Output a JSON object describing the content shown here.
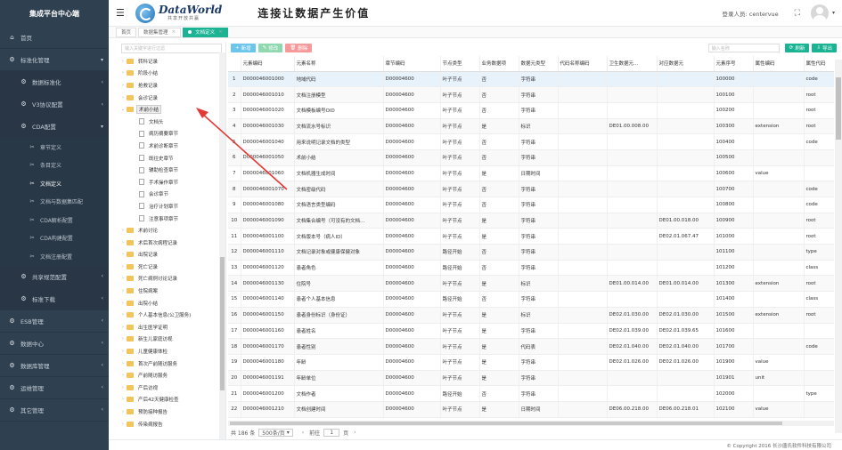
{
  "sidebar": {
    "brand": "集成平台中心端",
    "items": [
      {
        "icon": "home-icon",
        "label": "首页",
        "arrow": ""
      },
      {
        "icon": "gear-icon",
        "label": "标准化管理",
        "arrow": "▾"
      },
      {
        "icon": "gear-icon",
        "label": "数据标准化",
        "arrow": "‹",
        "sub": true
      },
      {
        "icon": "gear-icon",
        "label": "V3协议配置",
        "arrow": "‹",
        "sub": true
      },
      {
        "icon": "gear-icon",
        "label": "CDA配置",
        "arrow": "▾",
        "sub": true
      },
      {
        "icon": "wrench-icon",
        "label": "章节定义",
        "sub2": true
      },
      {
        "icon": "wrench-icon",
        "label": "条目定义",
        "sub2": true
      },
      {
        "icon": "wrench-icon",
        "label": "文档定义",
        "sub2": true,
        "current": true
      },
      {
        "icon": "wrench-icon",
        "label": "文档与数据集匹配",
        "sub2": true
      },
      {
        "icon": "wrench-icon",
        "label": "CDA解析配置",
        "sub2": true
      },
      {
        "icon": "wrench-icon",
        "label": "CDA构建配置",
        "sub2": true
      },
      {
        "icon": "wrench-icon",
        "label": "文档注册配置",
        "sub2": true
      },
      {
        "icon": "gear-icon",
        "label": "共享规范配置",
        "arrow": "‹",
        "sub": true
      },
      {
        "icon": "gear-icon",
        "label": "标准下载",
        "arrow": "‹",
        "sub": true
      },
      {
        "icon": "gear-icon",
        "label": "ESB管理",
        "arrow": "‹"
      },
      {
        "icon": "gear-icon",
        "label": "数据中心",
        "arrow": "‹"
      },
      {
        "icon": "gear-icon",
        "label": "数据库管理",
        "arrow": "‹"
      },
      {
        "icon": "gear-icon",
        "label": "运维管理",
        "arrow": "‹"
      },
      {
        "icon": "gear-icon",
        "label": "其它管理",
        "arrow": "‹"
      }
    ]
  },
  "header": {
    "logo_title": "DataWorld",
    "logo_sub": "共享开放共赢",
    "slogan": "连接让数据产生价值",
    "user_label": "登录人员: centervue"
  },
  "tabs": [
    {
      "label": "首页",
      "closable": false,
      "active": false
    },
    {
      "label": "数据集管理",
      "closable": true,
      "active": false
    },
    {
      "label": "文档定义",
      "closable": true,
      "active": true
    }
  ],
  "tree": {
    "search_placeholder": "输入关键字进行过滤",
    "nodes": [
      {
        "label": "转科记录",
        "level": 1,
        "type": "folder",
        "tog": "›"
      },
      {
        "label": "阶段小结",
        "level": 1,
        "type": "folder",
        "tog": "›"
      },
      {
        "label": "抢救记录",
        "level": 1,
        "type": "folder",
        "tog": "›"
      },
      {
        "label": "会诊记录",
        "level": 1,
        "type": "folder",
        "tog": "›"
      },
      {
        "label": "术前小结",
        "level": 1,
        "type": "folder",
        "tog": "⌄",
        "selected": true
      },
      {
        "label": "文档头",
        "level": 2,
        "type": "doc"
      },
      {
        "label": "病历摘要章节",
        "level": 2,
        "type": "doc"
      },
      {
        "label": "术前诊断章节",
        "level": 2,
        "type": "doc"
      },
      {
        "label": "既往史章节",
        "level": 2,
        "type": "doc"
      },
      {
        "label": "辅助检查章节",
        "level": 2,
        "type": "doc"
      },
      {
        "label": "手术操作章节",
        "level": 2,
        "type": "doc"
      },
      {
        "label": "会诊章节",
        "level": 2,
        "type": "doc"
      },
      {
        "label": "治疗计划章节",
        "level": 2,
        "type": "doc"
      },
      {
        "label": "注意事项章节",
        "level": 2,
        "type": "doc"
      },
      {
        "label": "术前讨论",
        "level": 1,
        "type": "folder",
        "tog": "›"
      },
      {
        "label": "术后首次病程记录",
        "level": 1,
        "type": "folder",
        "tog": "›"
      },
      {
        "label": "出院记录",
        "level": 1,
        "type": "folder",
        "tog": "›"
      },
      {
        "label": "死亡记录",
        "level": 1,
        "type": "folder",
        "tog": "›"
      },
      {
        "label": "死亡病例讨论记录",
        "level": 1,
        "type": "folder",
        "tog": "›"
      },
      {
        "label": "住院病案",
        "level": 1,
        "type": "folder",
        "tog": "›"
      },
      {
        "label": "出院小结",
        "level": 1,
        "type": "folder",
        "tog": "›"
      },
      {
        "label": "个人基本信息(公卫服务)",
        "level": 1,
        "type": "folder",
        "tog": "›"
      },
      {
        "label": "出生医学证明",
        "level": 1,
        "type": "folder",
        "tog": "›"
      },
      {
        "label": "新生儿家庭访视",
        "level": 1,
        "type": "folder",
        "tog": "›"
      },
      {
        "label": "儿童健康体检",
        "level": 1,
        "type": "folder",
        "tog": "›"
      },
      {
        "label": "首次产前随访服务",
        "level": 1,
        "type": "folder",
        "tog": "›"
      },
      {
        "label": "产前随访服务",
        "level": 1,
        "type": "folder",
        "tog": "›"
      },
      {
        "label": "产后访视",
        "level": 1,
        "type": "folder",
        "tog": "›"
      },
      {
        "label": "产后42天健康检查",
        "level": 1,
        "type": "folder",
        "tog": "›"
      },
      {
        "label": "预防接种报告",
        "level": 1,
        "type": "folder",
        "tog": "›"
      },
      {
        "label": "传染病报告",
        "level": 1,
        "type": "folder",
        "tog": "›"
      }
    ]
  },
  "toolbar": {
    "add": "新增",
    "edit": "修改",
    "delete": "删除",
    "search_placeholder": "输入名称",
    "refresh": "刷新",
    "export": "导出"
  },
  "table": {
    "columns": [
      "",
      "元素编码",
      "元素名称",
      "章节编码",
      "节点类型",
      "业务数据项",
      "数据元类型",
      "代码名称编码",
      "卫生数据元...",
      "对应数据元",
      "元素序号",
      "属性编码",
      "属性代码"
    ],
    "rows": [
      [
        "1",
        "D000046001000",
        "地域代码",
        "D00004600",
        "叶子节点",
        "否",
        "字符串",
        "",
        "",
        "",
        "100000",
        "",
        "code"
      ],
      [
        "2",
        "D000046001010",
        "文档注册模型",
        "D00004600",
        "叶子节点",
        "否",
        "字符串",
        "",
        "",
        "",
        "100100",
        "",
        "root"
      ],
      [
        "3",
        "D000046001020",
        "文档模板编号OID",
        "D00004600",
        "叶子节点",
        "否",
        "字符串",
        "",
        "",
        "",
        "100200",
        "",
        "root"
      ],
      [
        "4",
        "D000046001030",
        "文档流水号标识",
        "D00004600",
        "叶子节点",
        "是",
        "标识",
        "",
        "DE01.00.008.00",
        "",
        "100300",
        "extension",
        "root"
      ],
      [
        "5",
        "D000046001040",
        "用来说明记录文档的类型",
        "D00004600",
        "叶子节点",
        "否",
        "字符串",
        "",
        "",
        "",
        "100400",
        "",
        "code"
      ],
      [
        "6",
        "D000046001050",
        "术前小结",
        "D00004600",
        "叶子节点",
        "否",
        "字符串",
        "",
        "",
        "",
        "100500",
        "",
        ""
      ],
      [
        "7",
        "D000046001060",
        "文档机器生成时间",
        "D00004600",
        "叶子节点",
        "是",
        "日期时间",
        "",
        "",
        "",
        "100600",
        "value",
        ""
      ],
      [
        "8",
        "D000046001070",
        "文档密级代码",
        "D00004600",
        "叶子节点",
        "否",
        "字符串",
        "",
        "",
        "",
        "100700",
        "",
        "code"
      ],
      [
        "9",
        "D000046001080",
        "文档语言类型编码",
        "D00004600",
        "叶子节点",
        "否",
        "字符串",
        "",
        "",
        "",
        "100800",
        "",
        "code"
      ],
      [
        "10",
        "D000046001090",
        "文档集合编号（可没有的文档...",
        "D00004600",
        "叶子节点",
        "是",
        "字符串",
        "",
        "",
        "DE01.00.018.00",
        "100900",
        "",
        "root"
      ],
      [
        "11",
        "D000046001100",
        "文档版本号（病人ID）",
        "D00004600",
        "叶子节点",
        "是",
        "字符串",
        "",
        "",
        "DE02.01.067.47",
        "101000",
        "",
        "root"
      ],
      [
        "12",
        "D000046001110",
        "文档记录对象或健康保健对象",
        "D00004600",
        "路径开始",
        "否",
        "字符串",
        "",
        "",
        "",
        "101100",
        "",
        "type"
      ],
      [
        "13",
        "D000046001120",
        "患者角色",
        "D00004600",
        "路径开始",
        "否",
        "字符串",
        "",
        "",
        "",
        "101200",
        "",
        "class"
      ],
      [
        "14",
        "D000046001130",
        "住院号",
        "D00004600",
        "叶子节点",
        "是",
        "标识",
        "",
        "DE01.00.014.00",
        "DE01.00.014.00",
        "101300",
        "extension",
        "root"
      ],
      [
        "15",
        "D000046001140",
        "患者个人基本信息",
        "D00004600",
        "路径开始",
        "否",
        "字符串",
        "",
        "",
        "",
        "101400",
        "",
        "class"
      ],
      [
        "16",
        "D000046001150",
        "患者身份标识（身份证）",
        "D00004600",
        "叶子节点",
        "是",
        "标识",
        "",
        "DE02.01.030.00",
        "DE02.01.030.00",
        "101500",
        "extension",
        "root"
      ],
      [
        "17",
        "D000046001160",
        "患者姓名",
        "D00004600",
        "叶子节点",
        "是",
        "字符串",
        "",
        "DE02.01.039.00",
        "DE02.01.039.65",
        "101600",
        "",
        ""
      ],
      [
        "18",
        "D000046001170",
        "患者性别",
        "D00004600",
        "叶子节点",
        "是",
        "代码表",
        "",
        "DE02.01.040.00",
        "DE02.01.040.00",
        "101700",
        "",
        "code"
      ],
      [
        "19",
        "D000046001180",
        "年龄",
        "D00004600",
        "叶子节点",
        "是",
        "字符串",
        "",
        "DE02.01.026.00",
        "DE02.01.026.00",
        "101900",
        "value",
        ""
      ],
      [
        "20",
        "D000046001191",
        "年龄单位",
        "D00004600",
        "叶子节点",
        "是",
        "字符串",
        "",
        "",
        "",
        "101901",
        "unit",
        ""
      ],
      [
        "21",
        "D000046001200",
        "文档作者",
        "D00004600",
        "路径开始",
        "否",
        "字符串",
        "",
        "",
        "",
        "102000",
        "",
        "type"
      ],
      [
        "22",
        "D000046001210",
        "文档创建时间",
        "D00004600",
        "叶子节点",
        "是",
        "日期时间",
        "",
        "DE06.00.218.00",
        "DE06.00.218.01",
        "102100",
        "value",
        ""
      ]
    ]
  },
  "pager": {
    "total": "共 186 条",
    "size": "500条/页",
    "prev": "‹",
    "page": "1",
    "page_unit": "页",
    "next": "›",
    "goto": "前往"
  },
  "footer": "© Copyright 2016 长沙唐氏软件科技有限公司",
  "colors": {
    "sidebar_bg": "#2f4050",
    "accent": "#1ab394",
    "add_btn": "#6cc5ea",
    "edit_btn": "#8fd8b0",
    "delete_btn": "#f59a9a",
    "arrow": "#e53935"
  }
}
